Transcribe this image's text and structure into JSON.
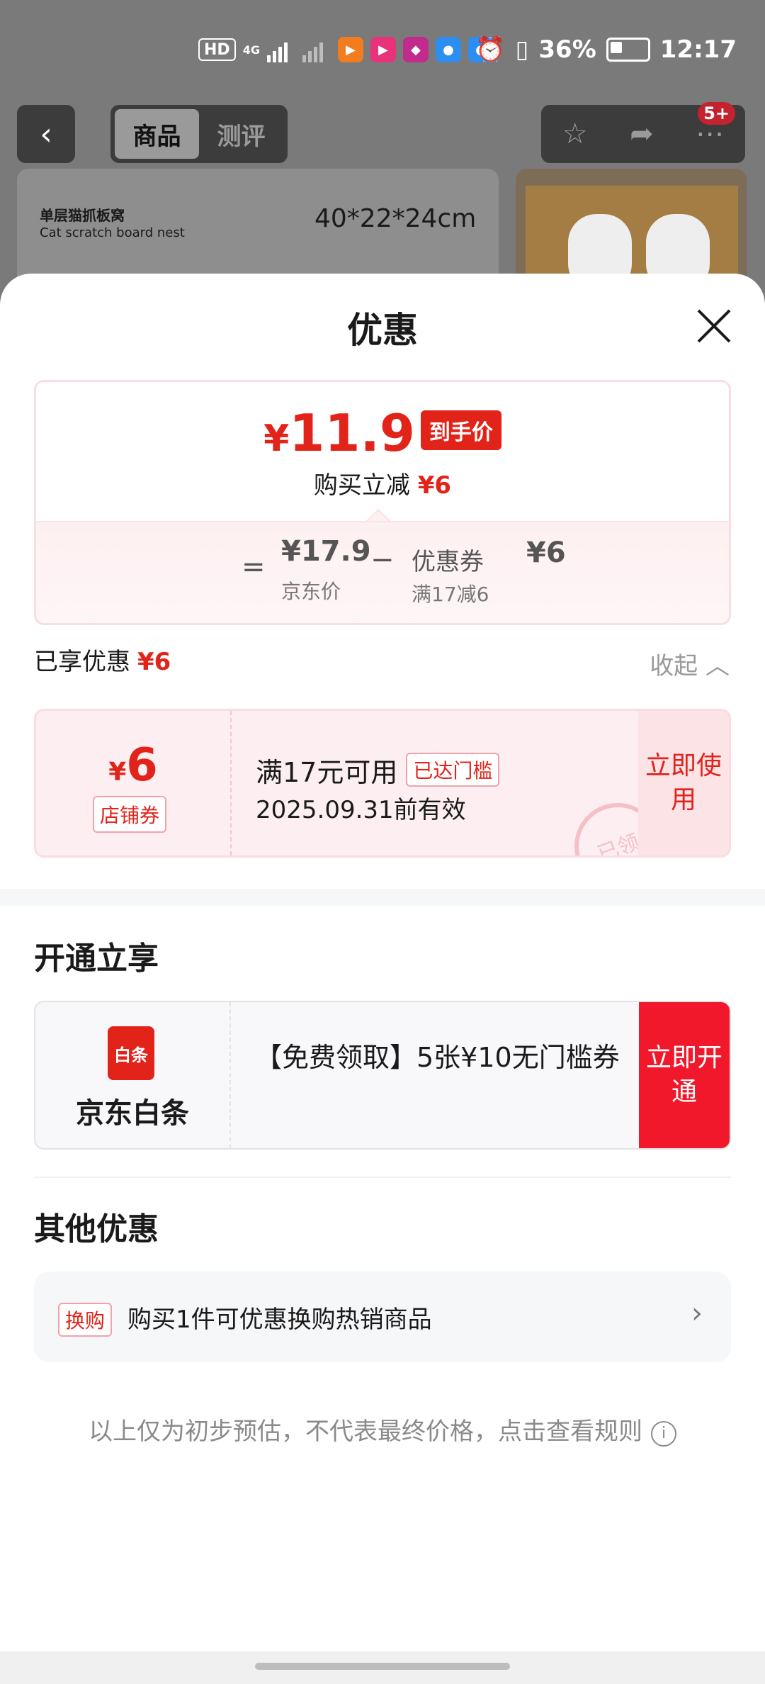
{
  "status_bar": {
    "hd": "HD",
    "net": "4G",
    "battery": "36%",
    "time": "12:17"
  },
  "nav": {
    "tabs": [
      {
        "label": "商品"
      },
      {
        "label": "测评"
      }
    ],
    "badge": "5+"
  },
  "product": {
    "name_cn": "单层猫抓板窝",
    "name_en": "Cat scratch board nest",
    "size": "40*22*24cm"
  },
  "sheet": {
    "title": "优惠",
    "final_price_symbol": "¥",
    "final_price": "11.9",
    "final_price_tag": "到手价",
    "reduce_text": "购买立减",
    "reduce_amount": "¥6",
    "equals": "=",
    "jd_price": "¥17.9",
    "jd_price_label": "京东价",
    "minus": "−",
    "coupon_label": "优惠券",
    "coupon_amount": "¥6",
    "coupon_condition": "满17减6",
    "enjoyed_label": "已享优惠",
    "enjoyed_amount": "¥6",
    "collapse_label": "收起"
  },
  "coupon_card": {
    "symbol": "¥",
    "amount": "6",
    "type": "店铺券",
    "condition": "满17元可用",
    "reached": "已达门槛",
    "validity": "2025.09.31前有效",
    "button": "立即使用",
    "stamp": "已领"
  },
  "section_open": {
    "title": "开通立享",
    "brand_logo_text": "白条",
    "brand_name": "京东白条",
    "desc": "【免费领取】5张¥10无门槛券",
    "button": "立即开通"
  },
  "section_other": {
    "title": "其他优惠",
    "tag": "换购",
    "text": "购买1件可优惠换购热销商品"
  },
  "footer": {
    "note": "以上仅为初步预估，不代表最终价格，点击查看规则"
  },
  "colors": {
    "accent": "#e2231a",
    "pink_bg": "#fdeff1"
  }
}
